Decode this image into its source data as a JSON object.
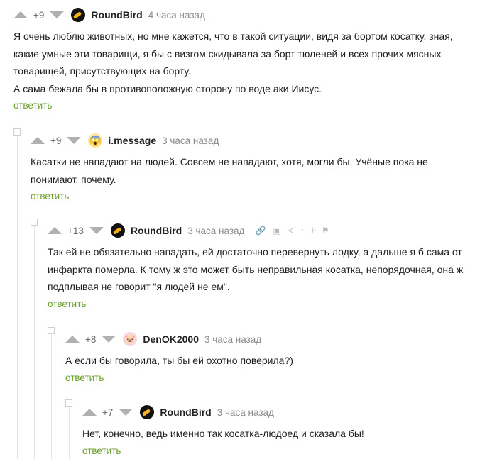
{
  "reply_label": "ответить",
  "comments": [
    {
      "rating": "+9",
      "user": "RoundBird",
      "time": "4 часа назад",
      "text": "Я очень люблю животных, но мне кажется, что в такой ситуации, видя за бортом косатку, зная, какие умные эти товарищи, я бы с визгом скидывала за борт тюленей и всех прочих мясных товарищей, присутствующих на борту.\nА сама бежала бы в противоположную сторону по воде аки Иисус."
    },
    {
      "rating": "+9",
      "user": "i.message",
      "time": "3 часа назад",
      "text": "Касатки не нападают на людей. Совсем не нападают, хотя, могли бы. Учёные пока не понимают, почему."
    },
    {
      "rating": "+13",
      "user": "RoundBird",
      "time": "3 часа назад",
      "text": "Так ей не обязательно нападать, ей достаточно перевернуть лодку, а дальше я б сама от инфаркта померла. К тому ж это может быть неправильная косатка, непорядочная, она ж подплывая не говорит \"я людей не ем\"."
    },
    {
      "rating": "+8",
      "user": "DenOK2000",
      "time": "3 часа назад",
      "text": "А если бы говорила, ты бы ей охотно поверила?)"
    },
    {
      "rating": "+7",
      "user": "RoundBird",
      "time": "3 часа назад",
      "text": "Нет, конечно, ведь именно так косатка-людоед и сказала бы!"
    }
  ],
  "tool_icons": [
    "link-icon",
    "save-icon",
    "share-icon",
    "move-up-icon",
    "branch-icon",
    "report-flag-icon"
  ]
}
